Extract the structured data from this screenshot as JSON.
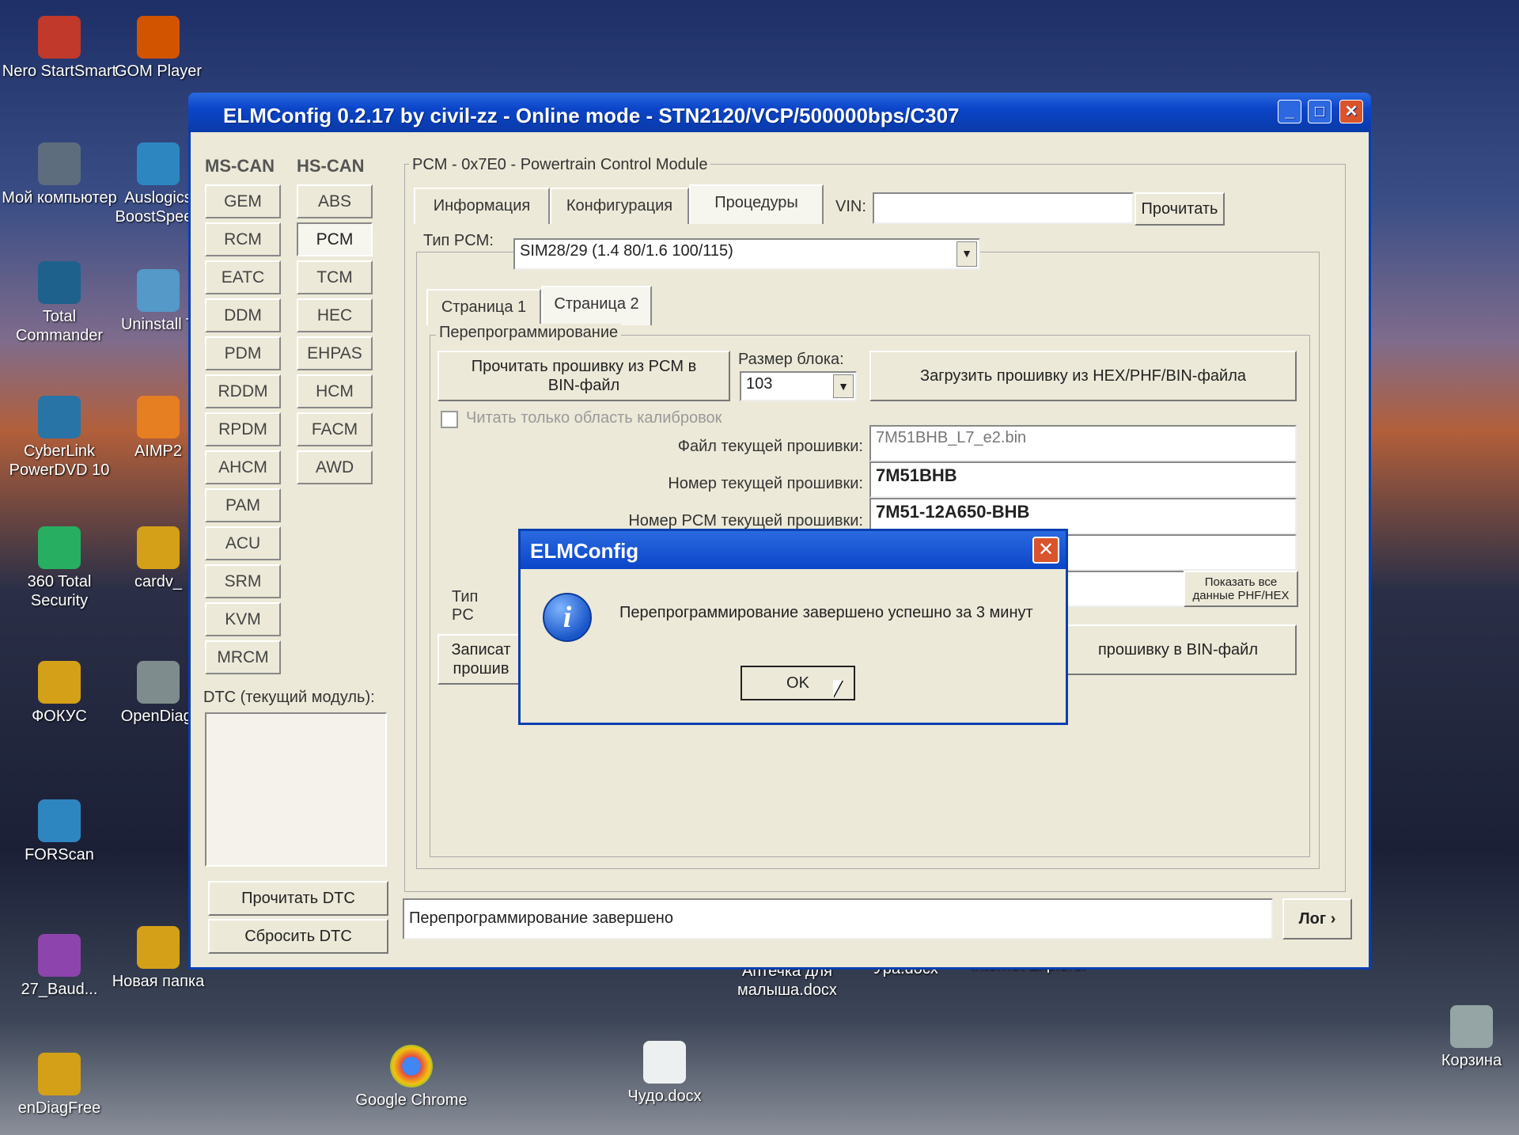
{
  "desktop": {
    "icons": [
      {
        "label": "Nero StartSmart",
        "color": "#c0392b"
      },
      {
        "label": "GOM Player",
        "color": "#d35400"
      },
      {
        "label": "Мой компьютер",
        "color": "#5d6d7e"
      },
      {
        "label": "Auslogics BoostSpeed",
        "color": "#2e86c1"
      },
      {
        "label": "Total Commander",
        "color": "#1f618d"
      },
      {
        "label": "Uninstall T",
        "color": "#5499c7"
      },
      {
        "label": "CyberLink PowerDVD 10",
        "color": "#2874a6"
      },
      {
        "label": "AIMP2",
        "color": "#e67e22"
      },
      {
        "label": "360 Total Security",
        "color": "#27ae60"
      },
      {
        "label": "cardv_",
        "color": "#d4a017"
      },
      {
        "label": "ФОКУС",
        "color": "#d4a017"
      },
      {
        "label": "OpenDiagl",
        "color": "#7f8c8d"
      },
      {
        "label": "FORScan",
        "color": "#2e86c1"
      },
      {
        "label": "27_Baud...",
        "color": "#8e44ad"
      },
      {
        "label": "Новая папка",
        "color": "#d4a017"
      },
      {
        "label": "Аптечка для малыша.docx",
        "color": "#2e86c1"
      },
      {
        "label": "Ура.docx",
        "color": "#2e86c1"
      },
      {
        "label": "Internet Explorer",
        "color": "#2e86c1"
      },
      {
        "label": "enDiagFree",
        "color": "#d4a017"
      },
      {
        "label": "Google Chrome",
        "color": "#e74c3c"
      },
      {
        "label": "Чудо.docx",
        "color": "#ecf0f1"
      },
      {
        "label": "Корзина",
        "color": "#95a5a6"
      }
    ]
  },
  "window": {
    "title": "ELMConfig 0.2.17 by civil-zz - Online mode - STN2120/VCP/500000bps/C307",
    "minimize": "_",
    "maximize": "□",
    "close": "✕"
  },
  "sidebar": {
    "ms_can_header": "MS-CAN",
    "hs_can_header": "HS-CAN",
    "ms_can": [
      "GEM",
      "RCM",
      "EATC",
      "DDM",
      "PDM",
      "RDDM",
      "RPDM",
      "AHCM",
      "PAM",
      "ACU",
      "SRM",
      "KVM",
      "MRCM"
    ],
    "hs_can": [
      "ABS",
      "PCM",
      "TCM",
      "HEC",
      "EHPAS",
      "HCM",
      "FACM",
      "AWD"
    ],
    "active": "PCM",
    "dtc_label": "DTC (текущий модуль):",
    "read_dtc": "Прочитать DTC",
    "clear_dtc": "Сбросить DTC"
  },
  "main": {
    "module_title": "PCM - 0x7E0 - Powertrain Control Module",
    "tabs": [
      "Информация",
      "Конфигурация",
      "Процедуры"
    ],
    "active_tab": "Процедуры",
    "vin_label": "VIN:",
    "vin_value": "",
    "read_button": "Прочитать",
    "pcm_type_label": "Тип PCM:",
    "pcm_type_value": "SIM28/29 (1.4 80/1.6 100/115)",
    "subtabs": [
      "Страница 1",
      "Страница 2"
    ],
    "active_subtab": "Страница 2",
    "reprog_legend": "Перепрограммирование",
    "read_fw_button": "Прочитать прошивку из PCM в BIN-файл",
    "block_size_label": "Размер блока:",
    "block_size_value": "103",
    "load_fw_button": "Загрузить прошивку из HEX/PHF/BIN-файла",
    "calib_only_checkbox": "Читать только область калибровок",
    "fields": [
      {
        "label": "Файл текущей прошивки:",
        "value": "7M51BHB_L7_e2.bin"
      },
      {
        "label": "Номер текущей прошивки:",
        "value": "7M51BHB"
      },
      {
        "label": "Номер PCM текущей прошивки:",
        "value": "7M51-12A650-BHB"
      }
    ],
    "type_pc_label": "Тип PC",
    "show_all_button": "Показать все данные PHF/HEX",
    "write_button": "Записат прошив",
    "save_bin_button": "прошивку в BIN-файл",
    "status_text": "Перепрограммирование завершено",
    "log_button": "Лог ›"
  },
  "dialog": {
    "title": "ELMConfig",
    "close": "✕",
    "icon": "info-icon",
    "message": "Перепрограммирование завершено успешно за 3 минут",
    "ok": "OK"
  }
}
